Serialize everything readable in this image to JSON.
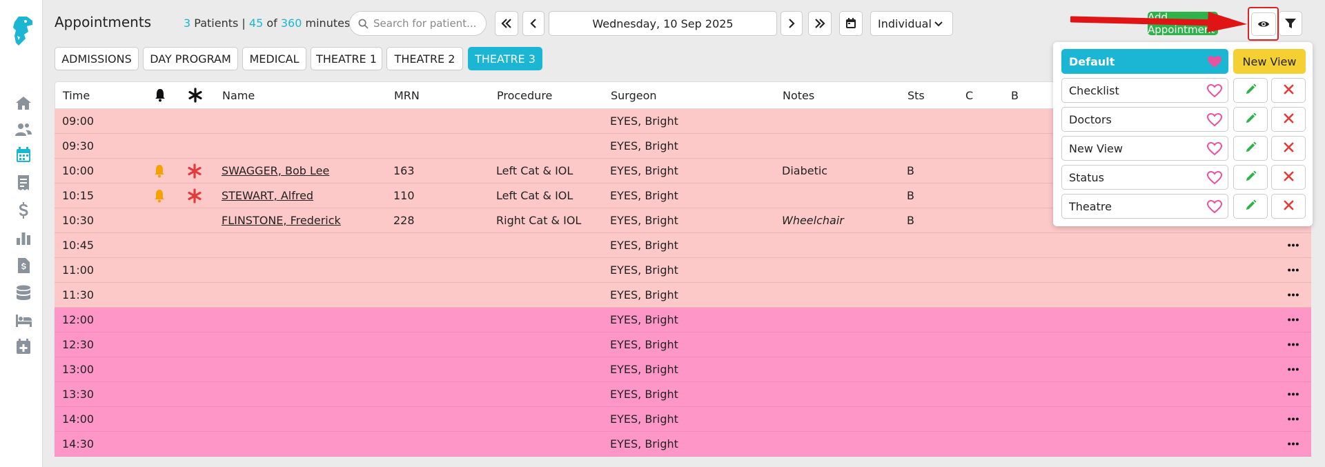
{
  "colors": {
    "accent": "#1ab6d4",
    "green": "#2db34a",
    "red": "#e23b3b",
    "orange": "#f5a100",
    "am_row": "#fcc8c8",
    "pm_row": "#ff96c8",
    "yellow": "#f5d033",
    "heart_pink": "#e8529e"
  },
  "sidebar": {
    "items": [
      {
        "name": "home-icon"
      },
      {
        "name": "users-icon"
      },
      {
        "name": "calendar-icon"
      },
      {
        "name": "receipt-icon"
      },
      {
        "name": "dollar-icon"
      },
      {
        "name": "bar-chart-icon"
      },
      {
        "name": "invoice-icon"
      },
      {
        "name": "database-icon"
      },
      {
        "name": "bed-icon"
      },
      {
        "name": "calendar-plus-icon"
      }
    ]
  },
  "header": {
    "title": "Appointments",
    "patients_count": "3",
    "patients_label": "Patients |",
    "minutes_used": "45",
    "of_label": "of",
    "minutes_total": "360",
    "minutes_label": "minutes",
    "search_placeholder": "Search for patient...",
    "date": "Wednesday, 10 Sep 2025",
    "view_mode": "Individual",
    "green_button_label": "Add Appointment"
  },
  "tabs": [
    {
      "label": "ADMISSIONS",
      "active": false
    },
    {
      "label": "DAY PROGRAM",
      "active": false
    },
    {
      "label": "MEDICAL",
      "active": false
    },
    {
      "label": "THEATRE 1",
      "active": false
    },
    {
      "label": "THEATRE 2",
      "active": false
    },
    {
      "label": "THEATRE 3",
      "active": true
    }
  ],
  "table": {
    "columns": {
      "time": "Time",
      "name": "Name",
      "mrn": "MRN",
      "procedure": "Procedure",
      "surgeon": "Surgeon",
      "notes": "Notes",
      "sts": "Sts",
      "c": "C",
      "b": "B"
    },
    "rows": [
      {
        "time": "09:00",
        "bell": false,
        "star": false,
        "name": "",
        "mrn": "",
        "procedure": "",
        "surgeon": "EYES, Bright",
        "notes": "",
        "notes_italic": false,
        "sts": "",
        "period": "am"
      },
      {
        "time": "09:30",
        "bell": false,
        "star": false,
        "name": "",
        "mrn": "",
        "procedure": "",
        "surgeon": "EYES, Bright",
        "notes": "",
        "notes_italic": false,
        "sts": "",
        "period": "am"
      },
      {
        "time": "10:00",
        "bell": true,
        "star": true,
        "name": "SWAGGER, Bob Lee",
        "mrn": "163",
        "procedure": "Left Cat & IOL",
        "surgeon": "EYES, Bright",
        "notes": "Diabetic",
        "notes_italic": false,
        "sts": "B",
        "period": "am"
      },
      {
        "time": "10:15",
        "bell": true,
        "star": true,
        "name": "STEWART, Alfred",
        "mrn": "110",
        "procedure": "Left Cat & IOL",
        "surgeon": "EYES, Bright",
        "notes": "",
        "notes_italic": false,
        "sts": "B",
        "period": "am"
      },
      {
        "time": "10:30",
        "bell": false,
        "star": false,
        "name": "FLINSTONE, Frederick",
        "mrn": "228",
        "procedure": "Right Cat & IOL",
        "surgeon": "EYES, Bright",
        "notes": "Wheelchair",
        "notes_italic": true,
        "sts": "B",
        "period": "am"
      },
      {
        "time": "10:45",
        "bell": false,
        "star": false,
        "name": "",
        "mrn": "",
        "procedure": "",
        "surgeon": "EYES, Bright",
        "notes": "",
        "notes_italic": false,
        "sts": "",
        "period": "am"
      },
      {
        "time": "11:00",
        "bell": false,
        "star": false,
        "name": "",
        "mrn": "",
        "procedure": "",
        "surgeon": "EYES, Bright",
        "notes": "",
        "notes_italic": false,
        "sts": "",
        "period": "am"
      },
      {
        "time": "11:30",
        "bell": false,
        "star": false,
        "name": "",
        "mrn": "",
        "procedure": "",
        "surgeon": "EYES, Bright",
        "notes": "",
        "notes_italic": false,
        "sts": "",
        "period": "am"
      },
      {
        "time": "12:00",
        "bell": false,
        "star": false,
        "name": "",
        "mrn": "",
        "procedure": "",
        "surgeon": "EYES, Bright",
        "notes": "",
        "notes_italic": false,
        "sts": "",
        "period": "pm"
      },
      {
        "time": "12:30",
        "bell": false,
        "star": false,
        "name": "",
        "mrn": "",
        "procedure": "",
        "surgeon": "EYES, Bright",
        "notes": "",
        "notes_italic": false,
        "sts": "",
        "period": "pm"
      },
      {
        "time": "13:00",
        "bell": false,
        "star": false,
        "name": "",
        "mrn": "",
        "procedure": "",
        "surgeon": "EYES, Bright",
        "notes": "",
        "notes_italic": false,
        "sts": "",
        "period": "pm"
      },
      {
        "time": "13:30",
        "bell": false,
        "star": false,
        "name": "",
        "mrn": "",
        "procedure": "",
        "surgeon": "EYES, Bright",
        "notes": "",
        "notes_italic": false,
        "sts": "",
        "period": "pm"
      },
      {
        "time": "14:00",
        "bell": false,
        "star": false,
        "name": "",
        "mrn": "",
        "procedure": "",
        "surgeon": "EYES, Bright",
        "notes": "",
        "notes_italic": false,
        "sts": "",
        "period": "pm"
      },
      {
        "time": "14:30",
        "bell": false,
        "star": false,
        "name": "",
        "mrn": "",
        "procedure": "",
        "surgeon": "EYES, Bright",
        "notes": "",
        "notes_italic": false,
        "sts": "",
        "period": "pm"
      }
    ]
  },
  "views_popover": {
    "new_view_label": "New View",
    "views": [
      {
        "label": "Default",
        "is_default": true
      },
      {
        "label": "Checklist",
        "is_default": false
      },
      {
        "label": "Doctors",
        "is_default": false
      },
      {
        "label": "New View",
        "is_default": false
      },
      {
        "label": "Status",
        "is_default": false
      },
      {
        "label": "Theatre",
        "is_default": false
      }
    ]
  }
}
